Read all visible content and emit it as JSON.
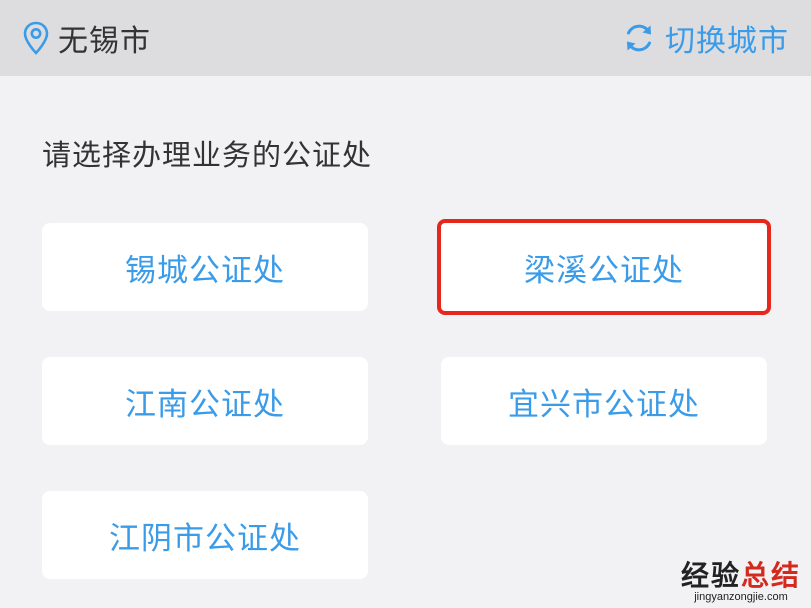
{
  "header": {
    "city": "无锡市",
    "switch_label": "切换城市",
    "location_icon": "location-pin-icon",
    "switch_icon": "refresh-icon",
    "accent_color": "#3a9be8",
    "background_color": "#dddde0"
  },
  "main": {
    "prompt": "请选择办理业务的公证处",
    "offices": [
      {
        "label": "锡城公证处",
        "selected": false
      },
      {
        "label": "梁溪公证处",
        "selected": true
      },
      {
        "label": "江南公证处",
        "selected": false
      },
      {
        "label": "宜兴市公证处",
        "selected": false
      },
      {
        "label": "江阴市公证处",
        "selected": false
      }
    ],
    "highlight_color": "#e8271c"
  },
  "watermark": {
    "main_black": "经验",
    "main_red": "总结",
    "sub": "jingyanzongjie.com"
  }
}
